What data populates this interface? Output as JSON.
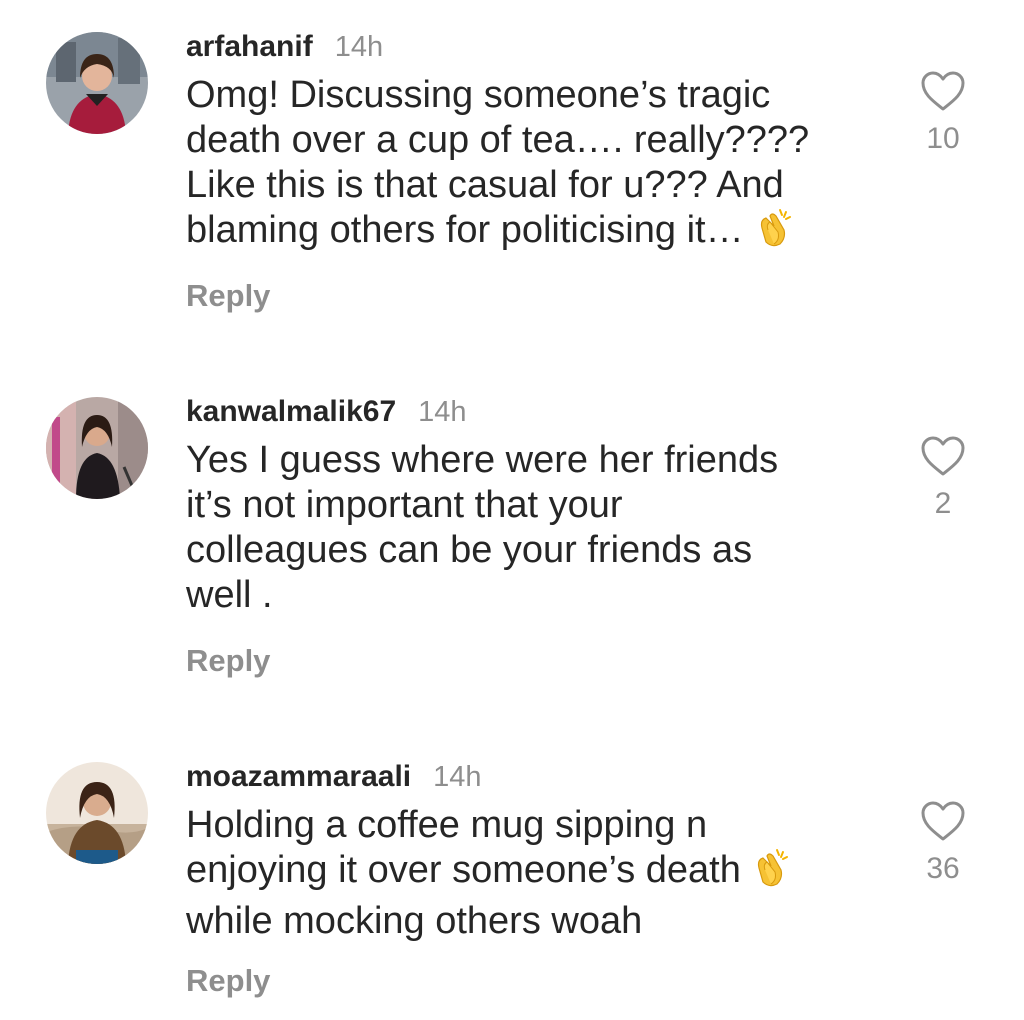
{
  "comments": [
    {
      "username": "arfahanif",
      "time": "14h",
      "lines": [
        "Omg! Discussing someone’s tragic",
        "death over a cup of tea…. really????",
        "Like this is that casual for u??? And",
        "blaming others for politicising it…"
      ],
      "emoji": "clapping-hands",
      "reply": "Reply",
      "likes": "10"
    },
    {
      "username": "kanwalmalik67",
      "time": "14h",
      "lines": [
        "Yes I guess where were her friends",
        "it’s not important that your",
        "colleagues can be your friends as",
        "well ."
      ],
      "reply": "Reply",
      "likes": "2"
    },
    {
      "username": "moazammaraali",
      "time": "14h",
      "lines": [
        "Holding a coffee mug sipping n",
        "enjoying it over someone’s death",
        "while mocking others woah"
      ],
      "emoji": "clapping-hands",
      "reply": "Reply",
      "likes": "36"
    }
  ],
  "colors": {
    "text": "#262626",
    "secondary": "#8e8e8e",
    "background": "#ffffff"
  },
  "icons": [
    "heart-outline-icon",
    "clapping-hands-emoji",
    "avatar"
  ]
}
